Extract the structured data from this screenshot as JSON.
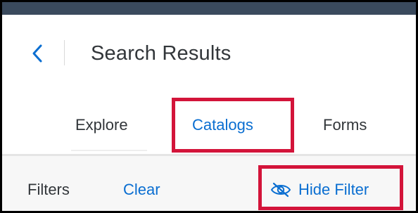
{
  "header": {
    "title": "Search Results",
    "back_icon": "chevron-left-icon"
  },
  "tabs": [
    {
      "label": "Explore",
      "active": false
    },
    {
      "label": "Catalogs",
      "active": true
    },
    {
      "label": "Forms",
      "active": false
    }
  ],
  "filterbar": {
    "filters_label": "Filters",
    "clear_label": "Clear",
    "hide_filter_label": "Hide Filter",
    "hide_filter_icon": "eye-slash-icon"
  },
  "colors": {
    "accent": "#0a6ed1",
    "text": "#32363a",
    "highlight": "#d3143a",
    "top_strip": "#3a4a5d"
  }
}
